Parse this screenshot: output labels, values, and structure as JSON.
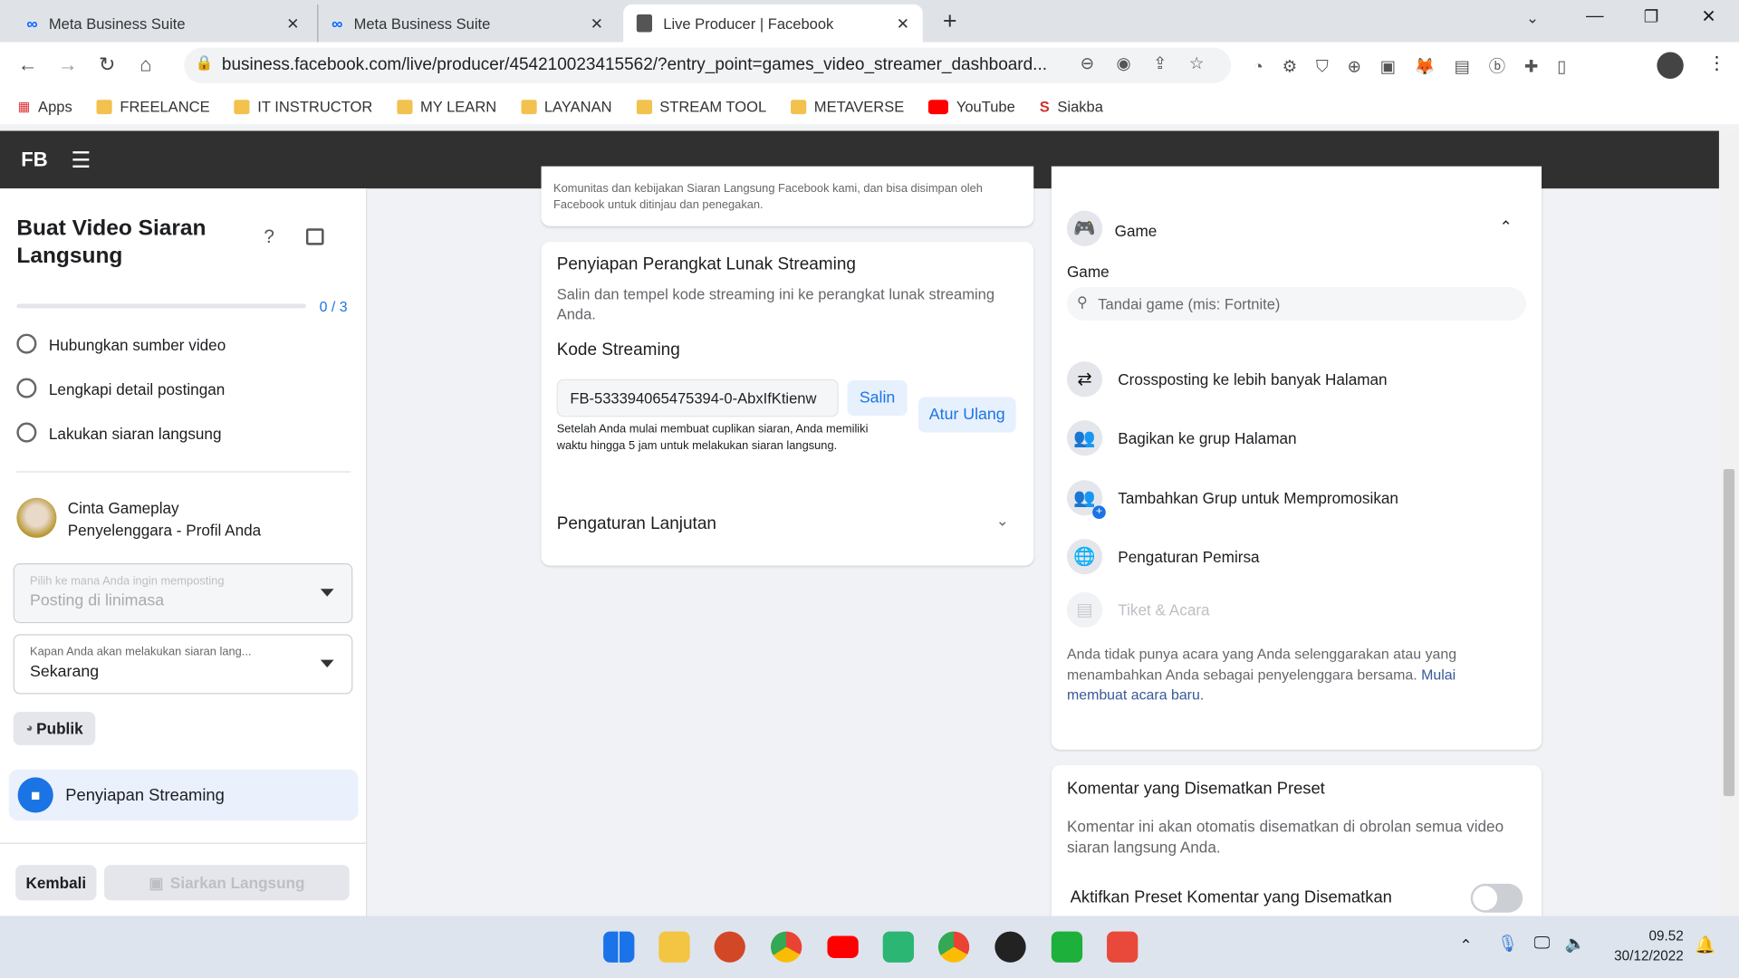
{
  "browser": {
    "tabs": [
      {
        "label": "Meta Business Suite",
        "icon": "meta-icon"
      },
      {
        "label": "Meta Business Suite",
        "icon": "meta-icon"
      },
      {
        "label": "Live Producer | Facebook",
        "icon": "page-icon",
        "active": true
      }
    ],
    "url": "business.facebook.com/live/producer/454210023415562/?entry_point=games_video_streamer_dashboard...",
    "bookmarks": [
      "Apps",
      "FREELANCE",
      "IT INSTRUCTOR",
      "MY LEARN",
      "LAYANAN",
      "STREAM TOOL",
      "METAVERSE",
      "YouTube",
      "Siakba"
    ]
  },
  "header": {
    "logo": "FB"
  },
  "sidebar": {
    "title": "Buat Video Siaran Langsung",
    "progress": {
      "value": 0,
      "total": 3,
      "label": "0 / 3"
    },
    "steps": [
      "Hubungkan sumber video",
      "Lengkapi detail postingan",
      "Lakukan siaran langsung"
    ],
    "profile": {
      "name": "Cinta Gameplay",
      "role": "Penyelenggara - Profil Anda"
    },
    "post_select": {
      "label": "Pilih ke mana Anda ingin memposting",
      "value": "Posting di linimasa"
    },
    "time_select": {
      "label": "Kapan Anda akan melakukan siaran lang...",
      "value": "Sekarang"
    },
    "privacy": "Publik",
    "active_section": "Penyiapan Streaming",
    "back": "Kembali",
    "go_live": "Siarkan Langsung"
  },
  "center": {
    "top_text_1": "Komunitas dan kebijakan Siaran Langsung Facebook kami, dan bisa disimpan oleh",
    "top_text_2": "Facebook untuk ditinjau dan penegakan.",
    "setup_title": "Penyiapan Perangkat Lunak Streaming",
    "setup_desc": "Salin dan tempel kode streaming ini ke perangkat lunak streaming Anda.",
    "key_title": "Kode Streaming",
    "key_value": "FB-533394065475394-0-AbxIfKtienw",
    "copy": "Salin",
    "reset": "Atur Ulang",
    "key_note": "Setelah Anda mulai membuat cuplikan siaran, Anda memiliki waktu hingga 5 jam untuk melakukan siaran langsung.",
    "advanced": "Pengaturan Lanjutan"
  },
  "right": {
    "game_header": "Game",
    "game_label": "Game",
    "game_placeholder": "Tandai game (mis: Fortnite)",
    "items": [
      "Crossposting ke lebih banyak Halaman",
      "Bagikan ke grup Halaman",
      "Tambahkan Grup untuk Mempromosikan",
      "Pengaturan Pemirsa",
      "Tiket & Acara"
    ],
    "events_text": "Anda tidak punya acara yang Anda selenggarakan atau yang menambahkan Anda sebagai penyelenggara bersama.",
    "events_link": "Mulai membuat acara baru.",
    "pinned_title": "Komentar yang Disematkan Preset",
    "pinned_desc": "Komentar ini akan otomatis disematkan di obrolan semua video siaran langsung Anda.",
    "pinned_toggle": "Aktifkan Preset Komentar yang Disematkan",
    "pinned_enabled": false
  },
  "taskbar": {
    "time": "09.52",
    "date": "30/12/2022"
  },
  "colors": {
    "accent": "#1b74e4",
    "header": "#303030"
  }
}
